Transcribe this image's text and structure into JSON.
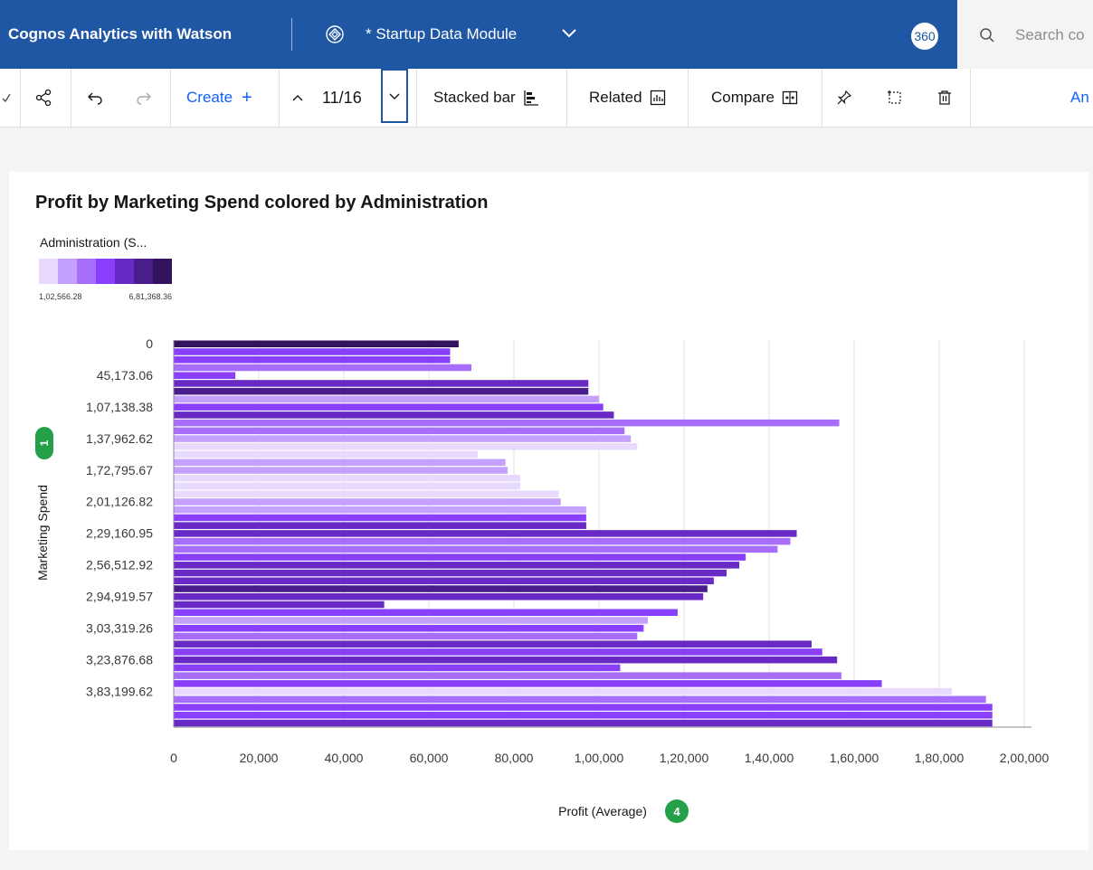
{
  "app": {
    "name": "Cognos Analytics with Watson",
    "module": "* Startup Data Module",
    "badge": "360",
    "search_placeholder": "Search co",
    "brand_color": "#1f57a4"
  },
  "toolbar": {
    "create": "Create",
    "page": "11/16",
    "stacked": "Stacked bar",
    "related": "Related",
    "compare": "Compare",
    "trailing": "An"
  },
  "chart_data": {
    "type": "bar",
    "orientation": "horizontal",
    "title": "Profit by Marketing Spend colored by Administration",
    "legend": {
      "title": "Administration (S...",
      "min_label": "1,02,566.28",
      "max_label": "6,81,368.36",
      "colors": [
        "#e8daff",
        "#c4a1ff",
        "#a66efa",
        "#8a3ffc",
        "#6929c4",
        "#491d8b",
        "#31135e"
      ],
      "placement": "top-left"
    },
    "xlabel": "Profit (Average)",
    "x_badge": "4",
    "ylabel": "Marketing Spend",
    "y_badge": "1",
    "xlim": [
      0,
      200000
    ],
    "xticks": [
      0,
      20000,
      40000,
      60000,
      80000,
      100000,
      120000,
      140000,
      160000,
      180000,
      200000
    ],
    "xtick_labels": [
      "0",
      "20,000",
      "40,000",
      "60,000",
      "80,000",
      "1,00,000",
      "1,20,000",
      "1,40,000",
      "1,60,000",
      "1,80,000",
      "2,00,000"
    ],
    "ytick_labels": [
      {
        "index": 0,
        "label": "0"
      },
      {
        "index": 4,
        "label": "45,173.06"
      },
      {
        "index": 8,
        "label": "1,07,138.38"
      },
      {
        "index": 12,
        "label": "1,37,962.62"
      },
      {
        "index": 16,
        "label": "1,72,795.67"
      },
      {
        "index": 20,
        "label": "2,01,126.82"
      },
      {
        "index": 24,
        "label": "2,29,160.95"
      },
      {
        "index": 28,
        "label": "2,56,512.92"
      },
      {
        "index": 32,
        "label": "2,94,919.57"
      },
      {
        "index": 36,
        "label": "3,03,319.26"
      },
      {
        "index": 40,
        "label": "3,23,876.68"
      },
      {
        "index": 44,
        "label": "3,83,199.62"
      }
    ],
    "values": [
      67000,
      65000,
      65000,
      70000,
      14500,
      97500,
      97500,
      100000,
      101000,
      103500,
      156500,
      106000,
      107500,
      109000,
      71500,
      78000,
      78500,
      81500,
      81500,
      90500,
      91000,
      97000,
      97000,
      97000,
      146500,
      145000,
      142000,
      134500,
      133000,
      130000,
      127000,
      125500,
      124500,
      49500,
      118500,
      111500,
      110500,
      109000,
      150000,
      152500,
      156000,
      105000,
      157000,
      166500,
      183000,
      191000,
      192500,
      192500,
      192500
    ],
    "admin_levels": [
      6,
      3,
      3,
      2,
      3,
      4,
      5,
      1,
      3,
      4,
      2,
      2,
      1,
      0,
      0,
      1,
      1,
      0,
      0,
      0,
      1,
      1,
      3,
      4,
      4,
      2,
      2,
      3,
      4,
      4,
      4,
      5,
      4,
      4,
      3,
      1,
      3,
      2,
      4,
      3,
      4,
      3,
      2,
      3,
      0,
      2,
      3,
      3,
      4,
      2
    ]
  }
}
